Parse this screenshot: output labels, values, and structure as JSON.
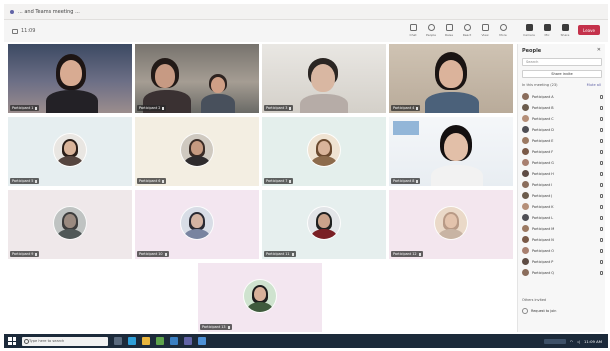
{
  "window": {
    "title": "... and Teams meeting ..."
  },
  "toolbar": {
    "timer": "11:09",
    "tools": [
      {
        "name": "chat",
        "label": "Chat"
      },
      {
        "name": "people",
        "label": "People"
      },
      {
        "name": "raise",
        "label": "Raise"
      },
      {
        "name": "react",
        "label": "React"
      },
      {
        "name": "view",
        "label": "View"
      },
      {
        "name": "more",
        "label": "More"
      },
      {
        "name": "camera",
        "label": "Camera"
      },
      {
        "name": "mic",
        "label": "Mic"
      },
      {
        "name": "share",
        "label": "Share"
      }
    ],
    "leave_label": "Leave"
  },
  "tiles": [
    {
      "id": "t1",
      "name": "Participant 1",
      "type": "video"
    },
    {
      "id": "t2",
      "name": "Participant 2",
      "type": "video"
    },
    {
      "id": "t3",
      "name": "Participant 3",
      "type": "video"
    },
    {
      "id": "t4",
      "name": "Participant 4",
      "type": "video"
    },
    {
      "id": "t5",
      "name": "Participant 5",
      "type": "avatar"
    },
    {
      "id": "t6",
      "name": "Participant 6",
      "type": "avatar"
    },
    {
      "id": "t7",
      "name": "Participant 7",
      "type": "avatar"
    },
    {
      "id": "t8",
      "name": "Participant 8",
      "type": "video"
    },
    {
      "id": "t9",
      "name": "Participant 9",
      "type": "avatar"
    },
    {
      "id": "t10",
      "name": "Participant 10",
      "type": "avatar"
    },
    {
      "id": "t11",
      "name": "Participant 11",
      "type": "avatar"
    },
    {
      "id": "t12",
      "name": "Participant 12",
      "type": "avatar"
    },
    {
      "id": "t13",
      "name": "Participant 13",
      "type": "avatar"
    }
  ],
  "panel": {
    "title": "People",
    "search_placeholder": "Search",
    "share_label": "Share invite",
    "section_label": "In this meeting (23)",
    "mute_all_label": "Mute all",
    "participants": [
      "Participant A",
      "Participant B",
      "Participant C",
      "Participant D",
      "Participant E",
      "Participant F",
      "Participant G",
      "Participant H",
      "Participant I",
      "Participant J",
      "Participant K",
      "Participant L",
      "Participant M",
      "Participant N",
      "Participant O",
      "Participant P",
      "Participant Q"
    ],
    "lower_section": "Others invited",
    "lower_item": "Request to join"
  },
  "taskbar": {
    "search_placeholder": "Type here to search",
    "tray_time": "11:09 AM"
  },
  "colors": {
    "teams_purple": "#6264a7",
    "leave_red": "#c4314b",
    "taskbar": "#1c2a3a"
  }
}
